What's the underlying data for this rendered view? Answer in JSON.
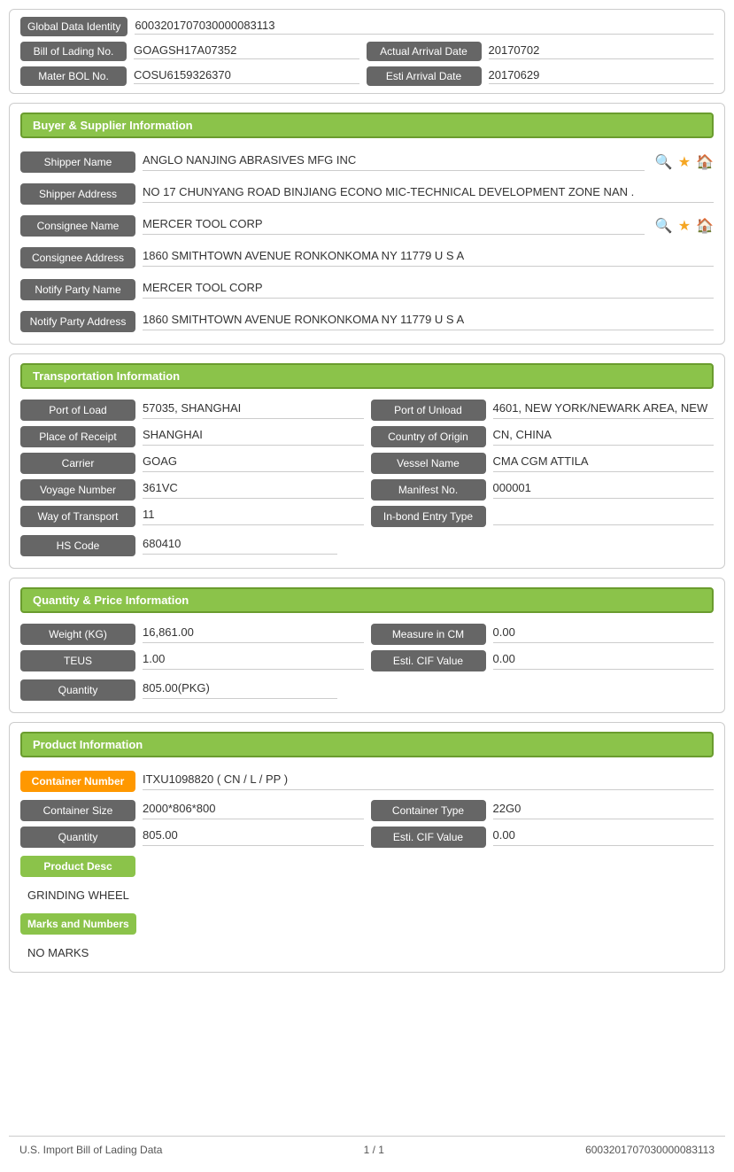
{
  "identity": {
    "global_data_label": "Global Data Identity",
    "global_data_value": "6003201707030000083113",
    "bol_label": "Bill of Lading No.",
    "bol_value": "GOAGSH17A07352",
    "actual_arrival_label": "Actual Arrival Date",
    "actual_arrival_value": "20170702",
    "mater_bol_label": "Mater BOL No.",
    "mater_bol_value": "COSU6159326370",
    "esti_arrival_label": "Esti Arrival Date",
    "esti_arrival_value": "20170629"
  },
  "buyer_supplier": {
    "title": "Buyer & Supplier Information",
    "shipper_name_label": "Shipper Name",
    "shipper_name_value": "ANGLO NANJING ABRASIVES MFG INC",
    "shipper_address_label": "Shipper Address",
    "shipper_address_value": "NO 17 CHUNYANG ROAD BINJIANG ECONO MIC-TECHNICAL DEVELOPMENT ZONE NAN .",
    "consignee_name_label": "Consignee Name",
    "consignee_name_value": "MERCER TOOL CORP",
    "consignee_address_label": "Consignee Address",
    "consignee_address_value": "1860 SMITHTOWN AVENUE RONKONKOMA NY 11779 U S A",
    "notify_party_name_label": "Notify Party Name",
    "notify_party_name_value": "MERCER TOOL CORP",
    "notify_party_address_label": "Notify Party Address",
    "notify_party_address_value": "1860 SMITHTOWN AVENUE RONKONKOMA NY 11779 U S A"
  },
  "transportation": {
    "title": "Transportation Information",
    "port_of_load_label": "Port of Load",
    "port_of_load_value": "57035, SHANGHAI",
    "port_of_unload_label": "Port of Unload",
    "port_of_unload_value": "4601, NEW YORK/NEWARK AREA, NEW",
    "place_of_receipt_label": "Place of Receipt",
    "place_of_receipt_value": "SHANGHAI",
    "country_of_origin_label": "Country of Origin",
    "country_of_origin_value": "CN, CHINA",
    "carrier_label": "Carrier",
    "carrier_value": "GOAG",
    "vessel_name_label": "Vessel Name",
    "vessel_name_value": "CMA CGM ATTILA",
    "voyage_number_label": "Voyage Number",
    "voyage_number_value": "361VC",
    "manifest_no_label": "Manifest No.",
    "manifest_no_value": "000001",
    "way_of_transport_label": "Way of Transport",
    "way_of_transport_value": "11",
    "in_bond_entry_label": "In-bond Entry Type",
    "in_bond_entry_value": "",
    "hs_code_label": "HS Code",
    "hs_code_value": "680410"
  },
  "quantity_price": {
    "title": "Quantity & Price Information",
    "weight_label": "Weight (KG)",
    "weight_value": "16,861.00",
    "measure_label": "Measure in CM",
    "measure_value": "0.00",
    "teus_label": "TEUS",
    "teus_value": "1.00",
    "esti_cif_label": "Esti. CIF Value",
    "esti_cif_value": "0.00",
    "quantity_label": "Quantity",
    "quantity_value": "805.00(PKG)"
  },
  "product": {
    "title": "Product Information",
    "container_number_label": "Container Number",
    "container_number_value": "ITXU1098820 ( CN / L / PP )",
    "container_size_label": "Container Size",
    "container_size_value": "2000*806*800",
    "container_type_label": "Container Type",
    "container_type_value": "22G0",
    "quantity_label": "Quantity",
    "quantity_value": "805.00",
    "esti_cif_label": "Esti. CIF Value",
    "esti_cif_value": "0.00",
    "product_desc_label": "Product Desc",
    "product_desc_value": "GRINDING WHEEL",
    "marks_label": "Marks and Numbers",
    "marks_value": "NO MARKS"
  },
  "footer": {
    "left": "U.S. Import Bill of Lading Data",
    "center": "1 / 1",
    "right": "6003201707030000083113"
  }
}
